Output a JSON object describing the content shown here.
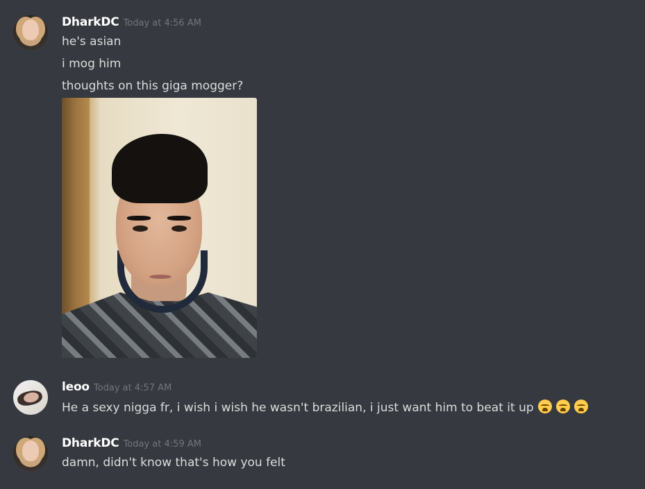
{
  "messages": [
    {
      "username": "DharkDC",
      "timestamp": "Today at 4:56 AM",
      "lines": [
        "he's asian",
        "i mog him",
        "thoughts on this giga mogger?"
      ],
      "attachment": "selfie photo"
    },
    {
      "username": "leoo",
      "timestamp": "Today at 4:57 AM",
      "lines": [
        "He a sexy nigga fr, i wish i wish he wasn't brazilian, i just want him to beat it up"
      ],
      "emojis": [
        "weary-face",
        "weary-face",
        "weary-face"
      ]
    },
    {
      "username": "DharkDC",
      "timestamp": "Today at 4:59 AM",
      "lines": [
        "damn, didn't know that's how you felt"
      ]
    }
  ],
  "colors": {
    "background": "#36393f",
    "username": "#ffffff",
    "text": "#dcddde",
    "timestamp": "#72767d"
  }
}
